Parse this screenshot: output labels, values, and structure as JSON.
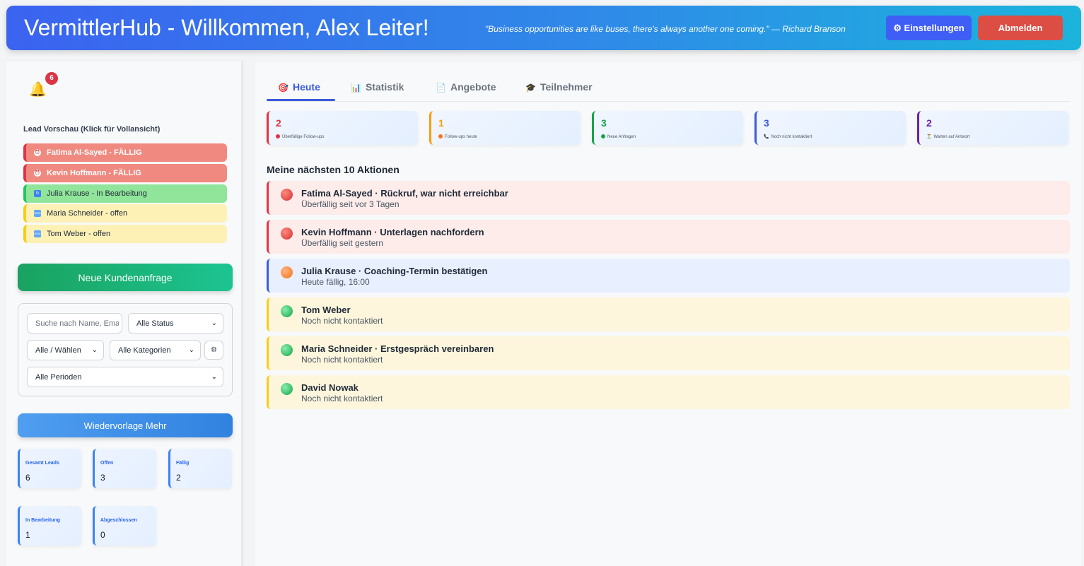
{
  "header": {
    "title": "VermittlerHub - Willkommen, Alex Leiter!",
    "quote": "\"Business opportunities are like buses, there's always another one coming.\" — Richard Branson",
    "settings_label": "⚙ Einstellungen",
    "logout_label": "Abmelden"
  },
  "sidebar": {
    "notification_count": "6",
    "lead_preview_title": "Lead Vorschau (Klick für Vollansicht)",
    "leads": [
      {
        "label": "Fatima Al-Sayed - FÄLLIG",
        "status": "due"
      },
      {
        "label": "Kevin Hoffmann - FÄLLIG",
        "status": "due"
      },
      {
        "label": "Julia Krause - In Bearbeitung",
        "status": "progress"
      },
      {
        "label": "Maria Schneider - offen",
        "status": "open"
      },
      {
        "label": "Tom Weber - offen",
        "status": "open"
      }
    ],
    "new_request_label": "Neue Kundenanfrage",
    "filters": {
      "search_placeholder": "Suche nach Name, Email",
      "status_value": "Alle Status",
      "select_value": "Alle / Wählen",
      "category_value": "Alle Kategorien",
      "period_value": "Alle Perioden"
    },
    "resubmission_label": "Wiedervorlage Mehr",
    "stats": [
      {
        "label": "Gesamt Leads",
        "value": "6"
      },
      {
        "label": "Offen",
        "value": "3"
      },
      {
        "label": "Fällig",
        "value": "2"
      },
      {
        "label": "In Bearbeitung",
        "value": "1"
      },
      {
        "label": "Abgeschlossen",
        "value": "0"
      }
    ]
  },
  "main": {
    "tabs": [
      {
        "label": "Heute",
        "icon": "target-icon",
        "active": true
      },
      {
        "label": "Statistik",
        "icon": "bar-chart-icon",
        "active": false
      },
      {
        "label": "Angebote",
        "icon": "document-icon",
        "active": false
      },
      {
        "label": "Teilnehmer",
        "icon": "graduation-cap-icon",
        "active": false
      }
    ],
    "kpis": [
      {
        "value": "2",
        "label": "Überfällige Follow-ups",
        "color": "#dc3545"
      },
      {
        "value": "1",
        "label": "Follow-ups heute",
        "color": "#f59e0b"
      },
      {
        "value": "3",
        "label": "Neue Anfragen",
        "color": "#16a34a"
      },
      {
        "value": "3",
        "label": "Noch nicht kontaktiert",
        "color": "#3b5bdb"
      },
      {
        "value": "2",
        "label": "Warten auf Antwort",
        "color": "#6b21a8"
      }
    ],
    "actions_title": "Meine nächsten 10 Aktionen",
    "actions": [
      {
        "title": "Fatima Al-Sayed · Rückruf, war nicht erreichbar",
        "subtitle": "Überfällig seit vor 3 Tagen",
        "tone": "red"
      },
      {
        "title": "Kevin Hoffmann · Unterlagen nachfordern",
        "subtitle": "Überfällig seit gestern",
        "tone": "red"
      },
      {
        "title": "Julia Krause · Coaching-Termin bestätigen",
        "subtitle": "Heute fällig, 16:00",
        "tone": "blue"
      },
      {
        "title": "Tom Weber",
        "subtitle": "Noch nicht kontaktiert",
        "tone": "yellow"
      },
      {
        "title": "Maria Schneider · Erstgespräch vereinbaren",
        "subtitle": "Noch nicht kontaktiert",
        "tone": "yellow"
      },
      {
        "title": "David Nowak",
        "subtitle": "Noch nicht kontaktiert",
        "tone": "yellow"
      }
    ]
  },
  "colors": {
    "accent": "#3b5bdb",
    "danger": "#dc3545",
    "success": "#1aa260"
  }
}
